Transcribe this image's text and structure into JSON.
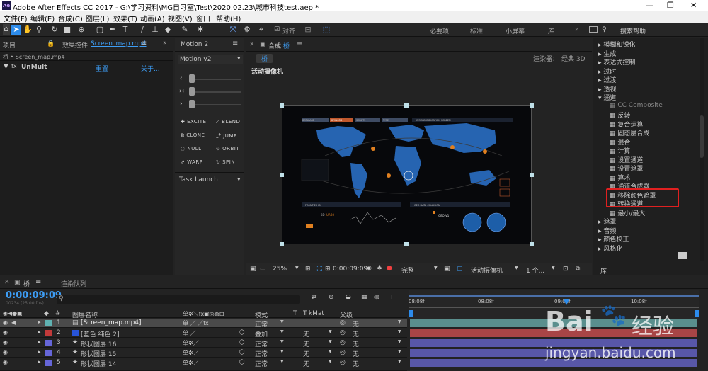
{
  "app": {
    "title": "Adobe After Effects CC 2017 - G:\\学习资料\\MG自习室\\Test\\2020.02.23\\城市科技test.aep *",
    "logo": "Ae"
  },
  "menu": [
    "文件(F)",
    "编辑(E)",
    "合成(C)",
    "图层(L)",
    "效果(T)",
    "动画(A)",
    "视图(V)",
    "窗口",
    "帮助(H)"
  ],
  "toolbar": {
    "snap_label": "对齐",
    "workspaces": [
      "必要项",
      "标准",
      "小屏幕",
      "库"
    ],
    "search_placeholder": "搜索帮助"
  },
  "project": {
    "tab": "项目",
    "fx_tab": "效果控件",
    "fx_file": "Screen_map.mp4",
    "breadcrumb": "桥 • Screen_map.mp4",
    "effect_name": "UnMult",
    "reset": "重置",
    "about": "关于..."
  },
  "motion": {
    "tab": "Motion 2",
    "version": "Motion v2",
    "buttons": [
      "EXCITE",
      "BLEND",
      "CLONE",
      "JUMP",
      "NULL",
      "ORBIT",
      "WARP",
      "SPIN"
    ],
    "task": "Task Launch"
  },
  "comp": {
    "tab_prefix": "合成",
    "name": "桥",
    "renderer_label": "渲染器：",
    "renderer": "经典 3D",
    "camera": "活动摄像机",
    "zoom": "25%",
    "timecode": "0:00:09:09",
    "quality": "完整",
    "view_camera": "活动摄像机",
    "views": "1 个..."
  },
  "map": {
    "dropdowns": [
      "DATABASE",
      "KEYWORD",
      "SCRIPTS",
      "TYPE"
    ],
    "header": "WORLD INDICATION SCREEN",
    "frontier": "FRONTIER ID",
    "geo_collision": "GEO DATA COLLISION",
    "geo_v1": "GEO V1",
    "code3d": "3D",
    "code_orange": "URB0"
  },
  "effects": {
    "items": [
      {
        "label": "模糊和锐化",
        "type": "folder",
        "open": false
      },
      {
        "label": "生成",
        "type": "folder",
        "open": false
      },
      {
        "label": "表达式控制",
        "type": "folder",
        "open": false
      },
      {
        "label": "过时",
        "type": "folder",
        "open": false
      },
      {
        "label": "过渡",
        "type": "folder",
        "open": false
      },
      {
        "label": "透视",
        "type": "folder",
        "open": false
      },
      {
        "label": "通道",
        "type": "folder",
        "open": true
      },
      {
        "label": "CC Composite",
        "type": "effect",
        "dim": true
      },
      {
        "label": "反转",
        "type": "effect"
      },
      {
        "label": "复合运算",
        "type": "effect"
      },
      {
        "label": "固态层合成",
        "type": "effect"
      },
      {
        "label": "混合",
        "type": "effect"
      },
      {
        "label": "计算",
        "type": "effect"
      },
      {
        "label": "设置通道",
        "type": "effect"
      },
      {
        "label": "设置遮罩",
        "type": "effect"
      },
      {
        "label": "算术",
        "type": "effect"
      },
      {
        "label": "通道合成器",
        "type": "effect"
      },
      {
        "label": "移除颜色遮罩",
        "type": "effect"
      },
      {
        "label": "转换通道",
        "type": "effect"
      },
      {
        "label": "最小/最大",
        "type": "effect"
      },
      {
        "label": "遮罩",
        "type": "folder",
        "open": false
      },
      {
        "label": "音频",
        "type": "folder",
        "open": false
      },
      {
        "label": "颜色校正",
        "type": "folder",
        "open": false
      },
      {
        "label": "风格化",
        "type": "folder",
        "open": false
      }
    ],
    "library_tab": "库"
  },
  "timeline": {
    "tab": "桥",
    "render_queue": "渲染队列",
    "timecode": "0:00:09:09",
    "fps": "00234 (25.00 fps)",
    "search_placeholder": "",
    "headers": {
      "layer_name": "图层名称",
      "mode": "模式",
      "t": "T",
      "trkmat": "TrkMat",
      "parent": "父级"
    },
    "ruler": [
      "08:08f",
      "08:08f",
      "09:08f",
      "10:08f"
    ],
    "layers": [
      {
        "num": "1",
        "name": "[Screen_map.mp4]",
        "color": "#5fb2b2",
        "mode": "正常",
        "trk": "",
        "parent": "无",
        "selected": true,
        "bar": "#5a8f8d"
      },
      {
        "num": "2",
        "name": "[蓝色 纯色 2]",
        "color": "#c23a3a",
        "mode": "叠加",
        "trk": "无",
        "parent": "无",
        "selected": false,
        "bar": "#a84546"
      },
      {
        "num": "3",
        "name": "形状图层 16",
        "color": "#6666d8",
        "mode": "正常",
        "trk": "无",
        "parent": "无",
        "selected": false,
        "bar": "#5857a8"
      },
      {
        "num": "4",
        "name": "形状图层 15",
        "color": "#6666d8",
        "mode": "正常",
        "trk": "无",
        "parent": "无",
        "selected": false,
        "bar": "#5857a8"
      },
      {
        "num": "5",
        "name": "形状图层 14",
        "color": "#6666d8",
        "mode": "正常",
        "trk": "无",
        "parent": "无",
        "selected": false,
        "bar": "#5857a8"
      }
    ]
  },
  "watermark": {
    "brand": "Bai",
    "brand2": "经验",
    "url": "jingyan.baidu.com"
  },
  "colors": {
    "accent": "#2d8ceb",
    "highlight_box": "#e02020",
    "timecode": "#3d9df5"
  }
}
